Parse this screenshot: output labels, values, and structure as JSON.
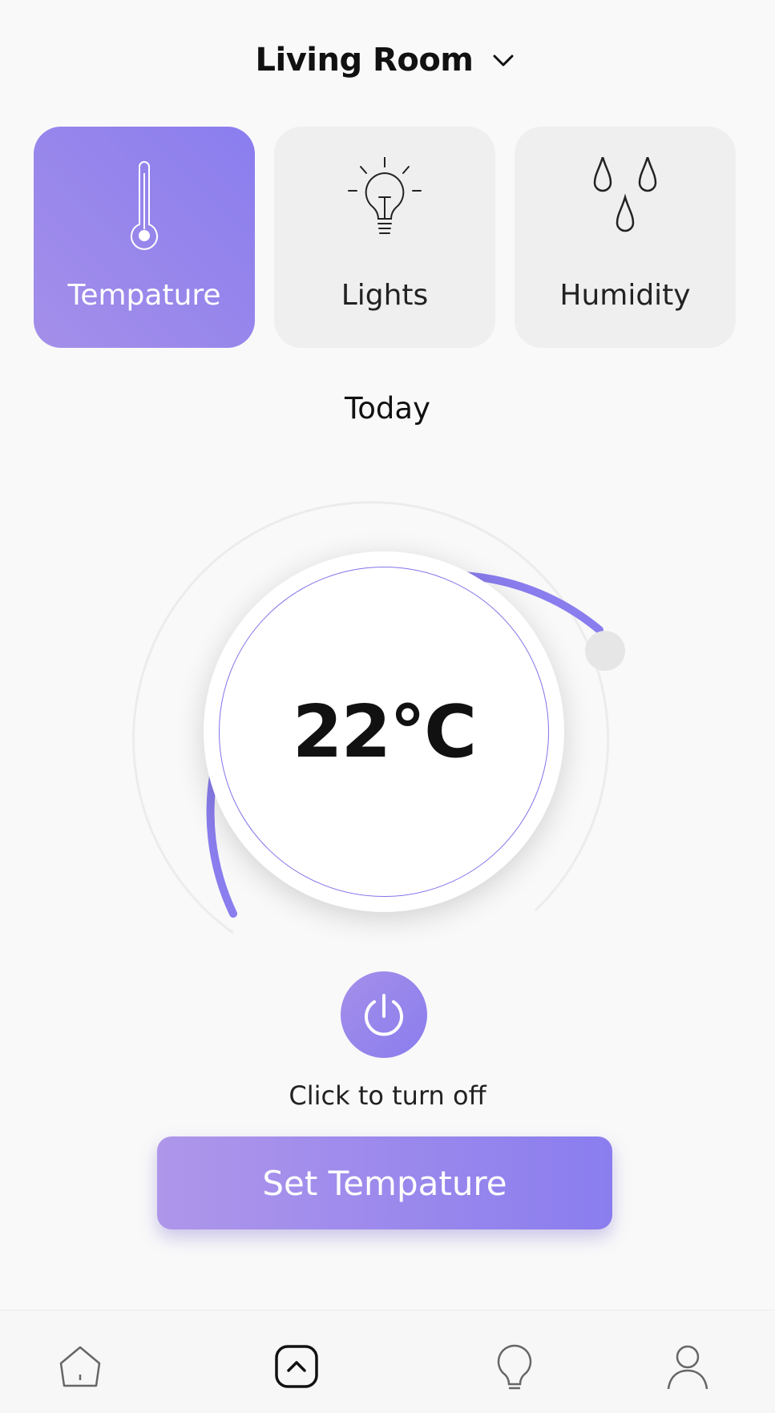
{
  "header": {
    "room": "Living Room"
  },
  "categories": [
    {
      "label": "Tempature",
      "icon": "thermometer-icon",
      "active": true
    },
    {
      "label": "Lights",
      "icon": "lightbulb-icon",
      "active": false
    },
    {
      "label": "Humidity",
      "icon": "droplets-icon",
      "active": false
    }
  ],
  "period_label": "Today",
  "dial": {
    "value": "22°C",
    "accent": "#8a7dee",
    "track": "#ececec"
  },
  "power": {
    "hint": "Click to turn off",
    "icon": "power-icon"
  },
  "set_button": {
    "label": "Set Tempature"
  },
  "nav": [
    {
      "icon": "home-icon",
      "active": false
    },
    {
      "icon": "chevron-up-square-icon",
      "active": true
    },
    {
      "icon": "lightbulb-outline-icon",
      "active": false
    },
    {
      "icon": "user-icon",
      "active": false
    }
  ]
}
